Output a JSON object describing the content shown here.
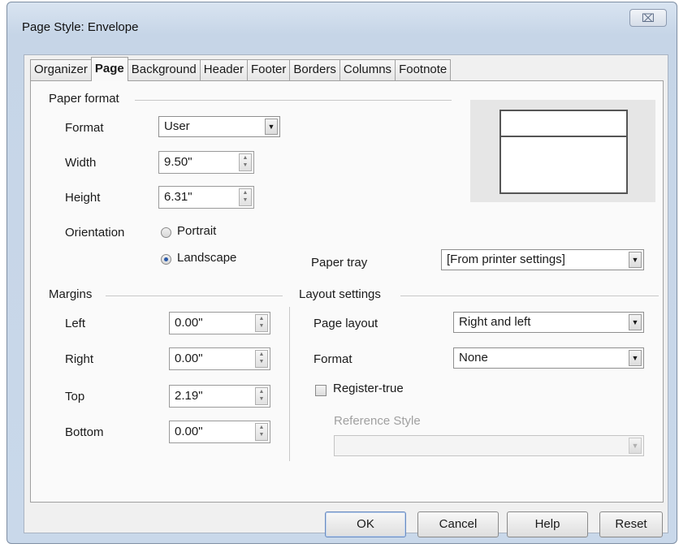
{
  "window": {
    "title": "Page Style: Envelope",
    "close_label": "⌧"
  },
  "tabs": [
    {
      "label": "Organizer",
      "active": false
    },
    {
      "label": "Page",
      "active": true
    },
    {
      "label": "Background",
      "active": false
    },
    {
      "label": "Header",
      "active": false
    },
    {
      "label": "Footer",
      "active": false
    },
    {
      "label": "Borders",
      "active": false
    },
    {
      "label": "Columns",
      "active": false
    },
    {
      "label": "Footnote",
      "active": false
    }
  ],
  "paper_format": {
    "group_label": "Paper format",
    "format_label": "Format",
    "format_value": "User",
    "width_label": "Width",
    "width_value": "9.50\"",
    "height_label": "Height",
    "height_value": "6.31\"",
    "orientation_label": "Orientation",
    "portrait_label": "Portrait",
    "landscape_label": "Landscape",
    "orientation_selected": "Landscape",
    "paper_tray_label": "Paper tray",
    "paper_tray_value": "[From printer settings]"
  },
  "margins": {
    "group_label": "Margins",
    "left_label": "Left",
    "left_value": "0.00\"",
    "right_label": "Right",
    "right_value": "0.00\"",
    "top_label": "Top",
    "top_value": "2.19\"",
    "bottom_label": "Bottom",
    "bottom_value": "0.00\""
  },
  "layout": {
    "group_label": "Layout settings",
    "page_layout_label": "Page layout",
    "page_layout_value": "Right and left",
    "format_label": "Format",
    "format_value": "None",
    "register_true_label": "Register-true",
    "register_true_checked": false,
    "reference_style_label": "Reference Style",
    "reference_style_value": ""
  },
  "buttons": {
    "ok": "OK",
    "cancel": "Cancel",
    "help": "Help",
    "reset": "Reset"
  }
}
